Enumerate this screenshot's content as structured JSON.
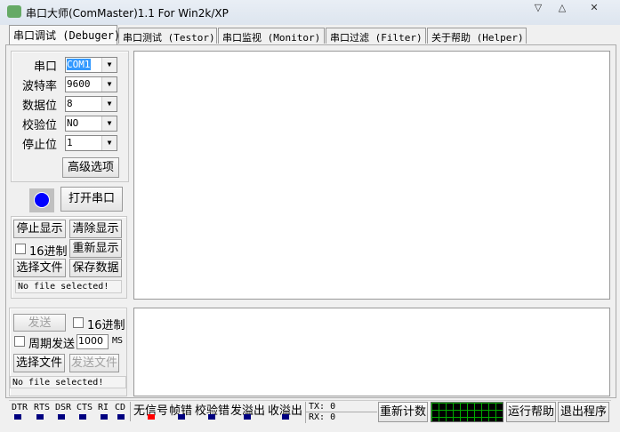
{
  "window": {
    "title": "串口大师(ComMaster)1.1 For Win2k/XP",
    "controls": [
      "▽",
      "△",
      "✕"
    ]
  },
  "tabs": [
    "串口调试 (Debuger)",
    "串口测试 (Testor)",
    "串口监视 (Monitor)",
    "串口过滤 (Filter)",
    "关于帮助 (Helper)"
  ],
  "settings": [
    {
      "label": "串口",
      "value": "COM1"
    },
    {
      "label": "波特率",
      "value": "9600"
    },
    {
      "label": "数据位",
      "value": "8"
    },
    {
      "label": "校验位",
      "value": "NO"
    },
    {
      "label": "停止位",
      "value": "1"
    }
  ],
  "advanced": "高级选项",
  "open_port": "打开串口",
  "led_color": "#0000ff",
  "receive": {
    "stop_display": "停止显示",
    "clear_display": "清除显示",
    "hex": "16进制",
    "redisplay": "重新显示",
    "select_file": "选择文件",
    "save_data": "保存数据",
    "status": "No file selected!"
  },
  "send": {
    "send": "发送",
    "hex": "16进制",
    "periodic": "周期发送",
    "period": "1000",
    "unit": "MS",
    "select_file": "选择文件",
    "send_file": "发送文件",
    "status": "No file selected!"
  },
  "statusbar": {
    "signals": [
      "DTR",
      "RTS",
      "DSR",
      "CTS",
      "RI",
      "CD"
    ],
    "indicators": [
      {
        "label": "无信号",
        "color": "#ff0000"
      },
      {
        "label": "帧错",
        "color": "#000080"
      },
      {
        "label": "校验错",
        "color": "#000080"
      },
      {
        "label": "发溢出",
        "color": "#000080"
      },
      {
        "label": "收溢出",
        "color": "#000080"
      }
    ],
    "tx": "TX: 0",
    "rx": "RX: 0",
    "reset": "重新计数",
    "help": "运行帮助",
    "exit": "退出程序"
  }
}
